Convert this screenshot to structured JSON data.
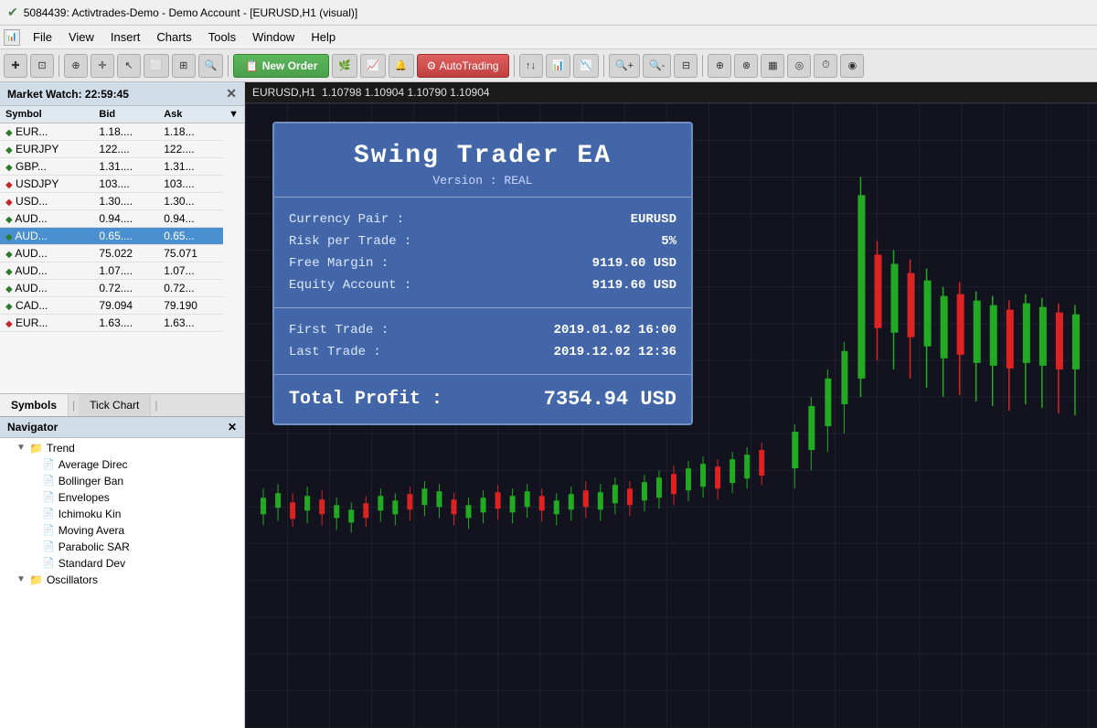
{
  "titleBar": {
    "checkmark": "✔",
    "title": "5084439: Activtrades-Demo - Demo Account - [EURUSD,H1 (visual)]"
  },
  "menuBar": {
    "items": [
      {
        "id": "file",
        "label": "File"
      },
      {
        "id": "view",
        "label": "View"
      },
      {
        "id": "insert",
        "label": "Insert"
      },
      {
        "id": "charts",
        "label": "Charts"
      },
      {
        "id": "tools",
        "label": "Tools"
      },
      {
        "id": "window",
        "label": "Window"
      },
      {
        "id": "help",
        "label": "Help"
      }
    ]
  },
  "toolbar": {
    "newOrderLabel": "New Order",
    "autoTradingLabel": "AutoTrading"
  },
  "marketWatch": {
    "title": "Market Watch: 22:59:45",
    "columns": [
      "Symbol",
      "Bid",
      "Ask"
    ],
    "rows": [
      {
        "symbol": "EUR...",
        "bid": "1.18....",
        "ask": "1.18...",
        "direction": "up"
      },
      {
        "symbol": "EURJPY",
        "bid": "122....",
        "ask": "122....",
        "direction": "up"
      },
      {
        "symbol": "GBP...",
        "bid": "1.31....",
        "ask": "1.31...",
        "direction": "up"
      },
      {
        "symbol": "USDJPY",
        "bid": "103....",
        "ask": "103....",
        "direction": "down"
      },
      {
        "symbol": "USD...",
        "bid": "1.30....",
        "ask": "1.30...",
        "direction": "down"
      },
      {
        "symbol": "AUD...",
        "bid": "0.94....",
        "ask": "0.94...",
        "direction": "up"
      },
      {
        "symbol": "AUD...",
        "bid": "0.65....",
        "ask": "0.65...",
        "direction": "up",
        "selected": true
      },
      {
        "symbol": "AUD...",
        "bid": "75.022",
        "ask": "75.071",
        "direction": "up"
      },
      {
        "symbol": "AUD...",
        "bid": "1.07....",
        "ask": "1.07...",
        "direction": "up"
      },
      {
        "symbol": "AUD...",
        "bid": "0.72....",
        "ask": "0.72...",
        "direction": "up"
      },
      {
        "symbol": "CAD...",
        "bid": "79.094",
        "ask": "79.190",
        "direction": "up"
      },
      {
        "symbol": "EUR...",
        "bid": "1.63....",
        "ask": "1.63...",
        "direction": "down"
      }
    ]
  },
  "tabs": {
    "symbols": "Symbols",
    "tickChart": "Tick Chart"
  },
  "navigator": {
    "title": "Navigator",
    "items": [
      {
        "type": "folder",
        "label": "Trend",
        "expanded": true,
        "indent": 1
      },
      {
        "type": "indicator",
        "label": "Average Direc",
        "indent": 2
      },
      {
        "type": "indicator",
        "label": "Bollinger Ban",
        "indent": 2
      },
      {
        "type": "indicator",
        "label": "Envelopes",
        "indent": 2
      },
      {
        "type": "indicator",
        "label": "Ichimoku Kin",
        "indent": 2
      },
      {
        "type": "indicator",
        "label": "Moving Avera",
        "indent": 2
      },
      {
        "type": "indicator",
        "label": "Parabolic SAR",
        "indent": 2
      },
      {
        "type": "indicator",
        "label": "Standard Dev",
        "indent": 2
      },
      {
        "type": "folder",
        "label": "Oscillators",
        "indent": 1
      }
    ]
  },
  "chartHeader": {
    "symbol": "EURUSD,H1",
    "prices": "1.10798 1.10904 1.10790 1.10904"
  },
  "eaPanel": {
    "title": "Swing Trader EA",
    "version": "Version : REAL",
    "rows": [
      {
        "label": "Currency Pair :",
        "value": "EURUSD"
      },
      {
        "label": "Risk per Trade :",
        "value": "5%"
      },
      {
        "label": "Free Margin :",
        "value": "9119.60 USD"
      },
      {
        "label": "Equity Account :",
        "value": "9119.60 USD"
      }
    ],
    "tradeRows": [
      {
        "label": "First Trade :",
        "value": "2019.01.02 16:00"
      },
      {
        "label": "Last Trade :",
        "value": "2019.12.02 12:36"
      }
    ],
    "profitLabel": "Total Profit :",
    "profitValue": "7354.94 USD"
  }
}
